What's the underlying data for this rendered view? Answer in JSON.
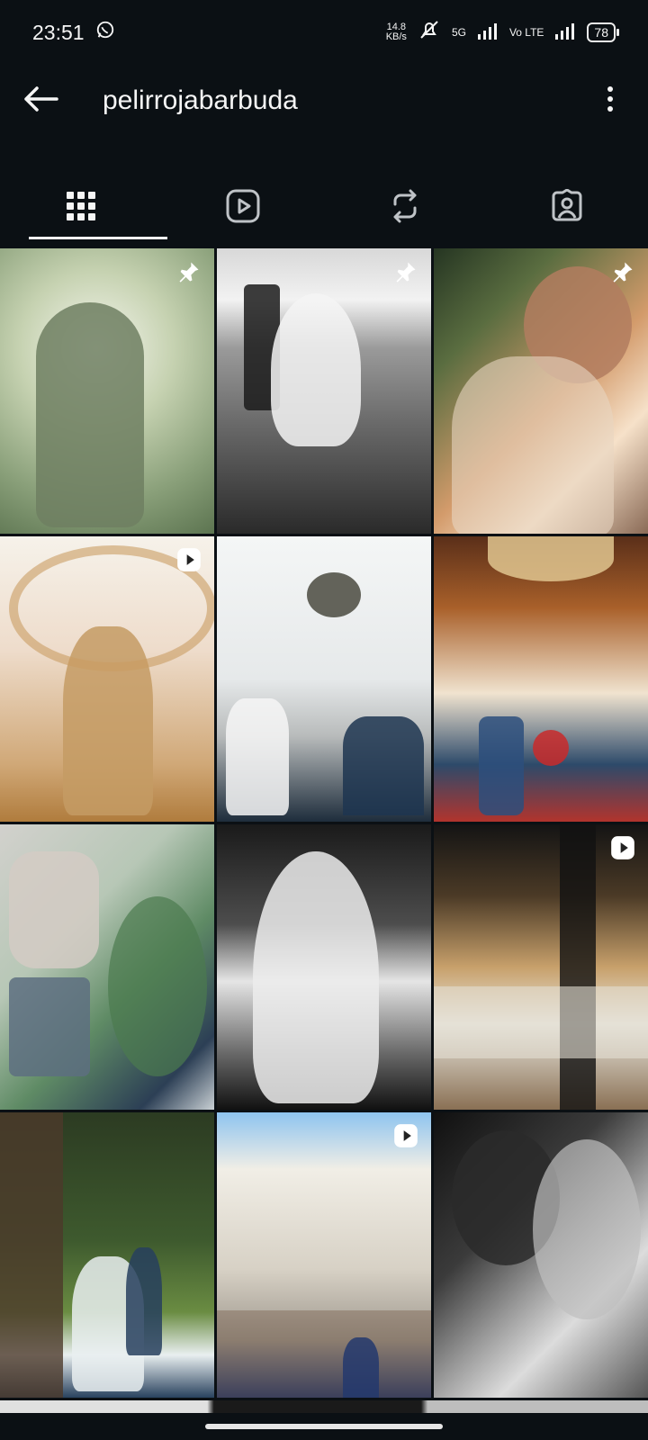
{
  "status": {
    "time": "23:51",
    "speed_value": "14.8",
    "speed_unit": "KB/s",
    "network": "5G",
    "volte": "Vo LTE",
    "battery": "78"
  },
  "header": {
    "title": "pelirrojabarbuda"
  },
  "tabs": [
    {
      "name": "posts-grid",
      "active": true
    },
    {
      "name": "reels",
      "active": false
    },
    {
      "name": "reposts",
      "active": false
    },
    {
      "name": "tagged",
      "active": false
    }
  ],
  "grid": [
    {
      "badge": "pin"
    },
    {
      "badge": "pin"
    },
    {
      "badge": "pin"
    },
    {
      "badge": "reel"
    },
    {
      "badge": "none"
    },
    {
      "badge": "none"
    },
    {
      "badge": "none"
    },
    {
      "badge": "none"
    },
    {
      "badge": "reel"
    },
    {
      "badge": "none"
    },
    {
      "badge": "reel"
    },
    {
      "badge": "none"
    }
  ],
  "colors": {
    "background": "#0b1014",
    "text": "#f5f5f5"
  }
}
